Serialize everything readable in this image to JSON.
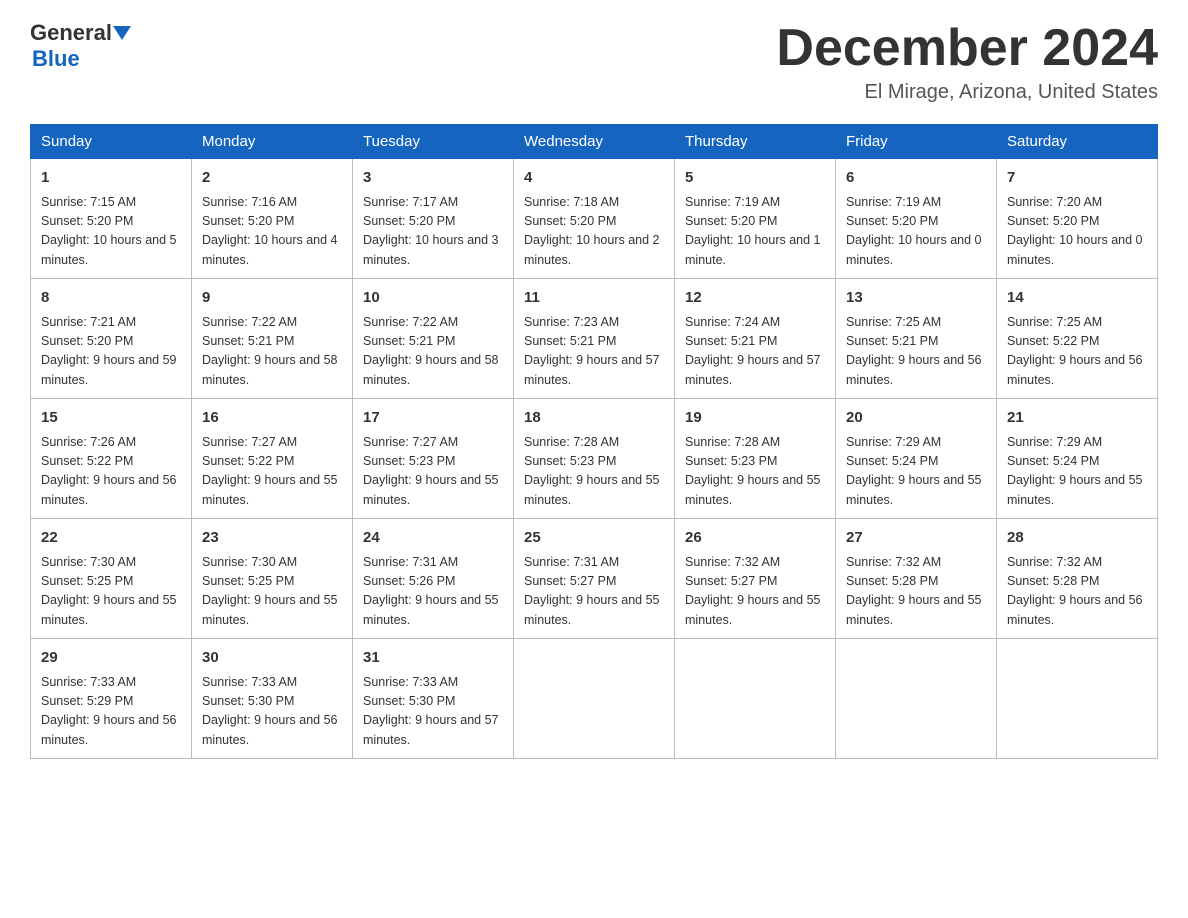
{
  "header": {
    "logo_line1": "General",
    "logo_line2": "Blue",
    "month_title": "December 2024",
    "location": "El Mirage, Arizona, United States"
  },
  "days_of_week": [
    "Sunday",
    "Monday",
    "Tuesday",
    "Wednesday",
    "Thursday",
    "Friday",
    "Saturday"
  ],
  "weeks": [
    [
      {
        "day": "1",
        "sunrise": "7:15 AM",
        "sunset": "5:20 PM",
        "daylight": "10 hours and 5 minutes."
      },
      {
        "day": "2",
        "sunrise": "7:16 AM",
        "sunset": "5:20 PM",
        "daylight": "10 hours and 4 minutes."
      },
      {
        "day": "3",
        "sunrise": "7:17 AM",
        "sunset": "5:20 PM",
        "daylight": "10 hours and 3 minutes."
      },
      {
        "day": "4",
        "sunrise": "7:18 AM",
        "sunset": "5:20 PM",
        "daylight": "10 hours and 2 minutes."
      },
      {
        "day": "5",
        "sunrise": "7:19 AM",
        "sunset": "5:20 PM",
        "daylight": "10 hours and 1 minute."
      },
      {
        "day": "6",
        "sunrise": "7:19 AM",
        "sunset": "5:20 PM",
        "daylight": "10 hours and 0 minutes."
      },
      {
        "day": "7",
        "sunrise": "7:20 AM",
        "sunset": "5:20 PM",
        "daylight": "10 hours and 0 minutes."
      }
    ],
    [
      {
        "day": "8",
        "sunrise": "7:21 AM",
        "sunset": "5:20 PM",
        "daylight": "9 hours and 59 minutes."
      },
      {
        "day": "9",
        "sunrise": "7:22 AM",
        "sunset": "5:21 PM",
        "daylight": "9 hours and 58 minutes."
      },
      {
        "day": "10",
        "sunrise": "7:22 AM",
        "sunset": "5:21 PM",
        "daylight": "9 hours and 58 minutes."
      },
      {
        "day": "11",
        "sunrise": "7:23 AM",
        "sunset": "5:21 PM",
        "daylight": "9 hours and 57 minutes."
      },
      {
        "day": "12",
        "sunrise": "7:24 AM",
        "sunset": "5:21 PM",
        "daylight": "9 hours and 57 minutes."
      },
      {
        "day": "13",
        "sunrise": "7:25 AM",
        "sunset": "5:21 PM",
        "daylight": "9 hours and 56 minutes."
      },
      {
        "day": "14",
        "sunrise": "7:25 AM",
        "sunset": "5:22 PM",
        "daylight": "9 hours and 56 minutes."
      }
    ],
    [
      {
        "day": "15",
        "sunrise": "7:26 AM",
        "sunset": "5:22 PM",
        "daylight": "9 hours and 56 minutes."
      },
      {
        "day": "16",
        "sunrise": "7:27 AM",
        "sunset": "5:22 PM",
        "daylight": "9 hours and 55 minutes."
      },
      {
        "day": "17",
        "sunrise": "7:27 AM",
        "sunset": "5:23 PM",
        "daylight": "9 hours and 55 minutes."
      },
      {
        "day": "18",
        "sunrise": "7:28 AM",
        "sunset": "5:23 PM",
        "daylight": "9 hours and 55 minutes."
      },
      {
        "day": "19",
        "sunrise": "7:28 AM",
        "sunset": "5:23 PM",
        "daylight": "9 hours and 55 minutes."
      },
      {
        "day": "20",
        "sunrise": "7:29 AM",
        "sunset": "5:24 PM",
        "daylight": "9 hours and 55 minutes."
      },
      {
        "day": "21",
        "sunrise": "7:29 AM",
        "sunset": "5:24 PM",
        "daylight": "9 hours and 55 minutes."
      }
    ],
    [
      {
        "day": "22",
        "sunrise": "7:30 AM",
        "sunset": "5:25 PM",
        "daylight": "9 hours and 55 minutes."
      },
      {
        "day": "23",
        "sunrise": "7:30 AM",
        "sunset": "5:25 PM",
        "daylight": "9 hours and 55 minutes."
      },
      {
        "day": "24",
        "sunrise": "7:31 AM",
        "sunset": "5:26 PM",
        "daylight": "9 hours and 55 minutes."
      },
      {
        "day": "25",
        "sunrise": "7:31 AM",
        "sunset": "5:27 PM",
        "daylight": "9 hours and 55 minutes."
      },
      {
        "day": "26",
        "sunrise": "7:32 AM",
        "sunset": "5:27 PM",
        "daylight": "9 hours and 55 minutes."
      },
      {
        "day": "27",
        "sunrise": "7:32 AM",
        "sunset": "5:28 PM",
        "daylight": "9 hours and 55 minutes."
      },
      {
        "day": "28",
        "sunrise": "7:32 AM",
        "sunset": "5:28 PM",
        "daylight": "9 hours and 56 minutes."
      }
    ],
    [
      {
        "day": "29",
        "sunrise": "7:33 AM",
        "sunset": "5:29 PM",
        "daylight": "9 hours and 56 minutes."
      },
      {
        "day": "30",
        "sunrise": "7:33 AM",
        "sunset": "5:30 PM",
        "daylight": "9 hours and 56 minutes."
      },
      {
        "day": "31",
        "sunrise": "7:33 AM",
        "sunset": "5:30 PM",
        "daylight": "9 hours and 57 minutes."
      },
      null,
      null,
      null,
      null
    ]
  ],
  "labels": {
    "sunrise_prefix": "Sunrise: ",
    "sunset_prefix": "Sunset: ",
    "daylight_prefix": "Daylight: "
  }
}
